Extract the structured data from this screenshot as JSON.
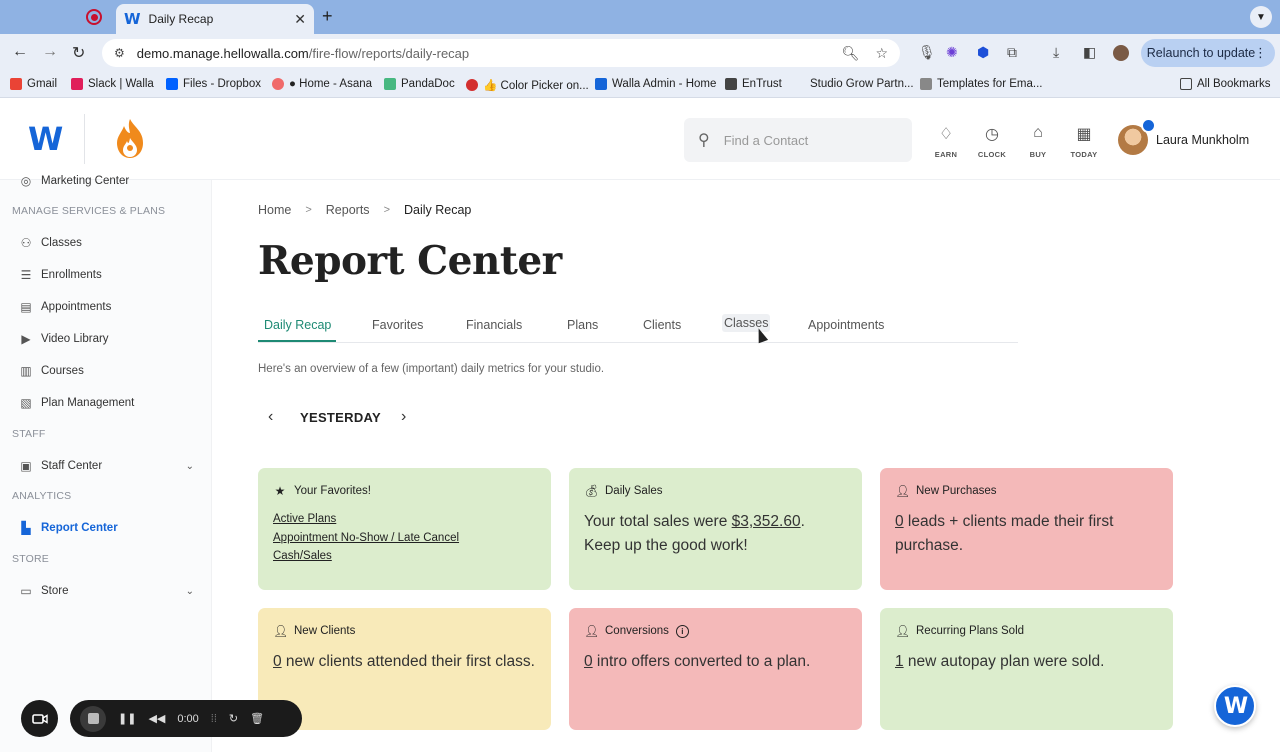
{
  "browser": {
    "tab_title": "Daily Recap",
    "url_host": "demo.manage.hellowalla.com",
    "url_path": "/fire-flow/reports/daily-recap",
    "relaunch_label": "Relaunch to update",
    "bookmarks": [
      {
        "label": "Gmail",
        "color": "#ea4335"
      },
      {
        "label": "Slack | Walla",
        "color": "#e01e5a"
      },
      {
        "label": "Files - Dropbox",
        "color": "#0061ff"
      },
      {
        "label": "● Home - Asana",
        "color": "#f06a6a"
      },
      {
        "label": "PandaDoc",
        "color": "#47b881"
      },
      {
        "label": "👍 Color Picker on...",
        "color": "#d32f2f"
      },
      {
        "label": "Walla Admin - Home",
        "color": "#1565d8"
      },
      {
        "label": "EnTrust",
        "color": "#444444"
      },
      {
        "label": "Studio Grow Partn...",
        "color": ""
      },
      {
        "label": "Templates for Ema...",
        "color": "#666666"
      }
    ],
    "all_bookmarks_label": "All Bookmarks"
  },
  "header": {
    "search_placeholder": "Find a Contact",
    "buttons": [
      {
        "label": "EARN",
        "icon": "diamond-sparkle-icon"
      },
      {
        "label": "CLOCK",
        "icon": "clock-icon"
      },
      {
        "label": "BUY",
        "icon": "tag-icon"
      },
      {
        "label": "TODAY",
        "icon": "calendar-icon"
      }
    ],
    "user_name": "Laura Munkholm"
  },
  "sidebar": {
    "items": [
      {
        "label": "Marketing Center",
        "icon": "target-icon"
      },
      {
        "label": "Classes",
        "icon": "group-icon"
      },
      {
        "label": "Enrollments",
        "icon": "chat-icon"
      },
      {
        "label": "Appointments",
        "icon": "calendar-check-icon"
      },
      {
        "label": "Video Library",
        "icon": "video-icon"
      },
      {
        "label": "Courses",
        "icon": "books-icon"
      },
      {
        "label": "Plan Management",
        "icon": "notebook-icon"
      },
      {
        "label": "Staff Center",
        "icon": "badge-icon"
      },
      {
        "label": "Report Center",
        "icon": "chart-icon"
      },
      {
        "label": "Store",
        "icon": "store-icon"
      }
    ],
    "sections": [
      "MANAGE SERVICES & PLANS",
      "STAFF",
      "ANALYTICS",
      "STORE"
    ]
  },
  "main": {
    "breadcrumb": [
      "Home",
      "Reports",
      "Daily Recap"
    ],
    "title": "Report Center",
    "tabs": [
      "Daily Recap",
      "Favorites",
      "Financials",
      "Plans",
      "Clients",
      "Classes",
      "Appointments"
    ],
    "active_tab": "Daily Recap",
    "overview": "Here's an overview of a few (important) daily metrics for your studio.",
    "date_label": "YESTERDAY"
  },
  "cards": {
    "favorites": {
      "title": "Your Favorites!",
      "links": [
        "Active Plans",
        "Appointment No-Show / Late Cancel",
        "Cash/Sales"
      ]
    },
    "daily_sales": {
      "title": "Daily Sales",
      "prefix": "Your total sales were ",
      "amount": "$3,352.60",
      "suffix": ".",
      "line2": "Keep up the good work!"
    },
    "new_purchases": {
      "title": "New Purchases",
      "count": "0",
      "text": " leads + clients made their first purchase."
    },
    "new_clients": {
      "title": "New Clients",
      "count": "0",
      "text": " new clients attended their first class."
    },
    "conversions": {
      "title": "Conversions",
      "count": "0",
      "text": " intro offers converted to a plan."
    },
    "recurring": {
      "title": "Recurring Plans Sold",
      "count": "1",
      "text": " new autopay plan were sold."
    }
  },
  "recorder": {
    "time": "0:00"
  },
  "colors": {
    "brand": "#1565d8",
    "active_tab": "#1e8a74",
    "green_card": "#dcedcd",
    "red_card": "#f4b9b9",
    "yellow_card": "#f8eab9"
  }
}
